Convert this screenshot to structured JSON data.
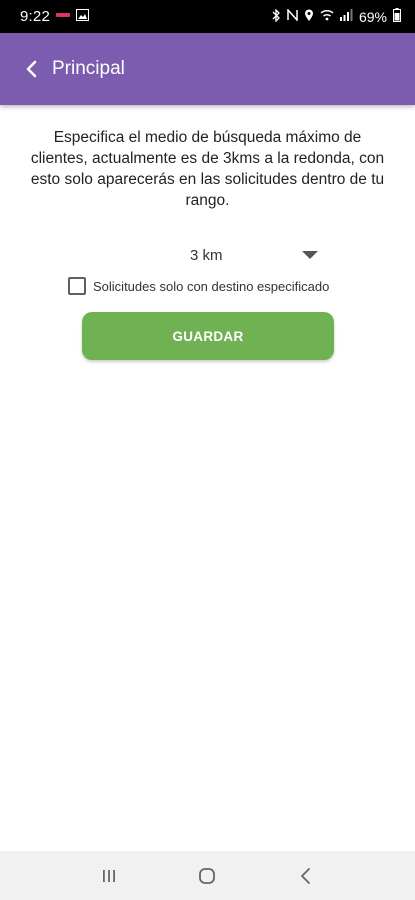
{
  "status_bar": {
    "time": "9:22",
    "battery": "69%",
    "left_icons": [
      "carrier-icon",
      "image-icon"
    ],
    "right_icons": [
      "bluetooth-icon",
      "nfc-icon",
      "location-icon",
      "wifi-icon",
      "signal-icon"
    ]
  },
  "app_bar": {
    "title": "Principal",
    "color": "#7b5cae"
  },
  "content": {
    "description": "Especifica el medio de búsqueda máximo de clientes, actualmente es de 3kms a la redonda, con esto solo aparecerás en las solicitudes dentro de tu rango.",
    "radius_select": {
      "value": "3 km"
    },
    "destination_checkbox": {
      "label": "Solicitudes solo con destino especificado",
      "checked": false
    },
    "save_button": {
      "label": "GUARDAR",
      "color": "#6fb153"
    }
  },
  "nav_bar": {
    "buttons": [
      "recent-apps-icon",
      "home-icon",
      "back-icon"
    ]
  }
}
